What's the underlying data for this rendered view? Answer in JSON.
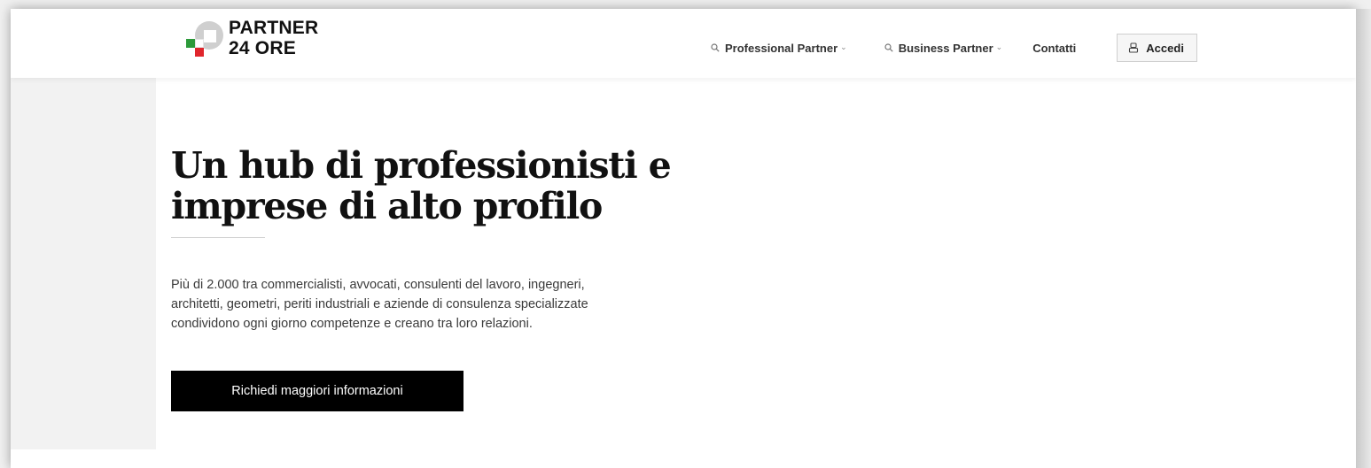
{
  "header": {
    "logo": {
      "line1": "PARTNER",
      "line2": "24 ORE"
    },
    "nav": [
      {
        "label": "Professional Partner",
        "icon": "search-icon",
        "dropdown": true
      },
      {
        "label": "Business Partner",
        "icon": "search-icon",
        "dropdown": true
      },
      {
        "label": "Contatti"
      }
    ],
    "login": {
      "label": "Accedi",
      "icon": "user-icon"
    }
  },
  "hero": {
    "title_line1": "Un hub di professionisti e",
    "title_line2": "imprese di alto profilo",
    "description_line1": "Più di 2.000 tra commercialisti, avvocati, consulenti del lavoro, ingegneri,",
    "description_line2": "architetti, geometri, periti industriali e aziende di consulenza specializzate",
    "description_line3": "condividono ogni giorno competenze e creano tra loro relazioni.",
    "cta_label": "Richiedi maggiori informazioni"
  },
  "colors": {
    "flag_green": "#2c9a3a",
    "flag_red": "#e0262c",
    "cta_background": "#000000",
    "side_panel": "#f2f2f2"
  }
}
